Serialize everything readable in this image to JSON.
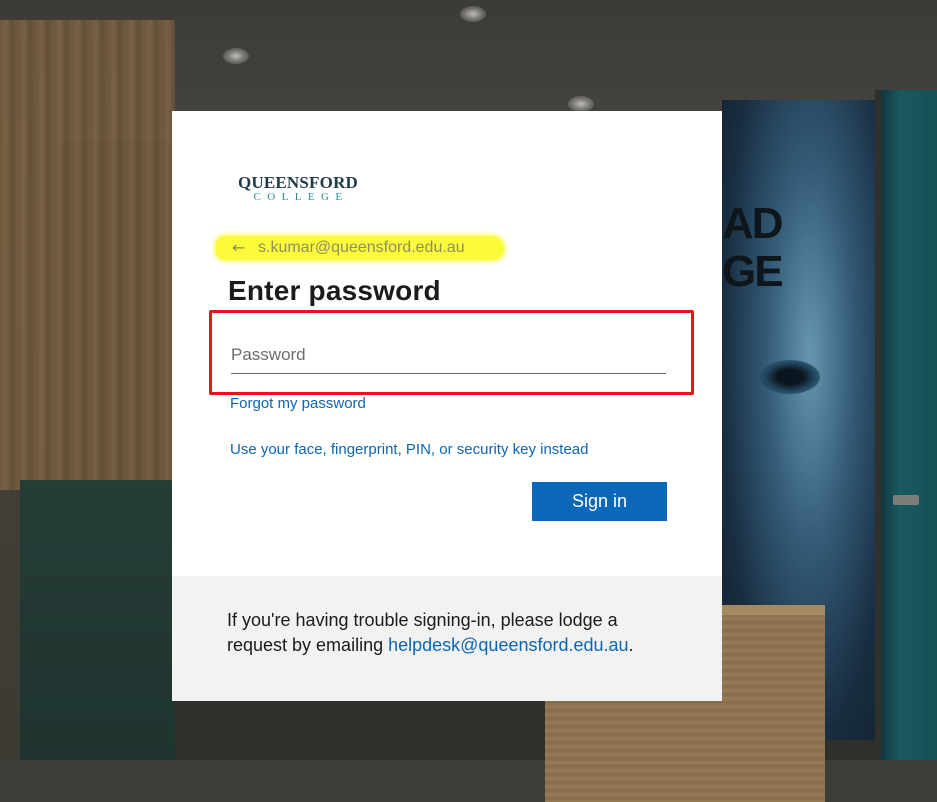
{
  "background": {
    "mural_text": [
      "AD",
      "GE"
    ]
  },
  "logo": {
    "line1": "QUEENSFORD",
    "line2": "COLLEGE"
  },
  "identity": {
    "back_icon": "arrow-left-icon",
    "email": "s.kumar@queensford.edu.au"
  },
  "title": "Enter password",
  "password": {
    "placeholder": "Password",
    "value": ""
  },
  "links": {
    "forgot": "Forgot my password",
    "alt_auth": "Use your face, fingerprint, PIN, or security key instead"
  },
  "signin_label": "Sign in",
  "footer": {
    "text_before": "If you're having trouble signing-in, please lodge a request by emailing ",
    "email_link": "helpdesk@queensford.edu.au",
    "text_after": "."
  },
  "colors": {
    "accent": "#0b67b7",
    "link": "#0e66b0",
    "highlight": "#fbfb3b",
    "annotation_box": "#e8141b"
  }
}
